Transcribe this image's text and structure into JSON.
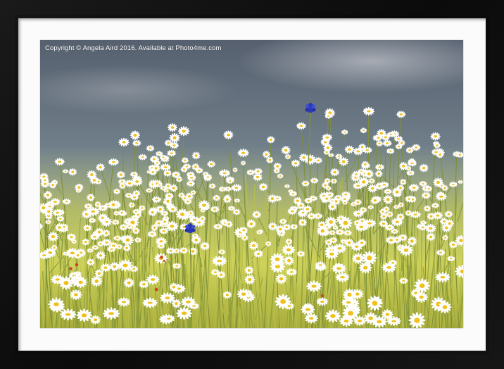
{
  "image": {
    "watermark": "Copyright  © Angela Aird  2016. Available at Photo4me.com"
  },
  "colors": {
    "frame": "#111111",
    "mount": "#fbfbfb",
    "sky_top": "#5d6b78",
    "sky_bottom": "#8fa3a9",
    "grass": "#c9cf5a",
    "daisy_petal": "#ffffff",
    "daisy_center": "#f2c21b",
    "cornflower": "#2f3fbf"
  },
  "scene": {
    "subject": "wild daisy meadow",
    "flowers": [
      "daisy",
      "cornflower"
    ]
  }
}
